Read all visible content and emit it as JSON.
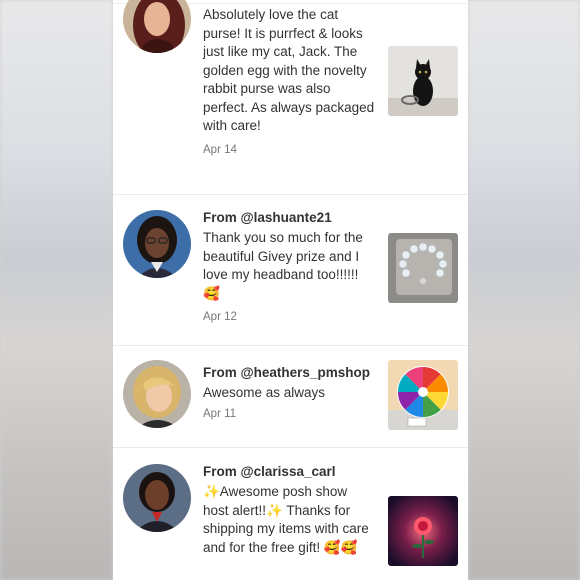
{
  "reviews": [
    {
      "from": "",
      "text": "Absolutely love the cat purse! It is purrfect & looks just like my cat, Jack. The golden egg with the novelty rabbit purse was also perfect. As always packaged with care!",
      "date": "Apr 14",
      "avatar_icon": "woman-with-red-hair-avatar",
      "thumb_icon": "black-cat-purse-photo"
    },
    {
      "from": "From @lashuante21",
      "text": "Thank you so much for the beautiful Givey prize and I love my headband too!!!!!!🥰",
      "date": "Apr 12",
      "avatar_icon": "woman-with-glasses-avatar",
      "thumb_icon": "bead-bracelet-photo"
    },
    {
      "from": "From @heathers_pmshop",
      "text": "Awesome as always",
      "date": "Apr 11",
      "avatar_icon": "blonde-woman-avatar",
      "thumb_icon": "prize-wheel-photo"
    },
    {
      "from": "From @clarissa_carl",
      "text": "✨Awesome posh show host alert!!✨ Thanks for shipping my items with care and for the free gift! 🥰🥰",
      "date": "",
      "avatar_icon": "smiling-woman-avatar",
      "thumb_icon": "rose-art-photo"
    }
  ],
  "colors": {
    "text": "#333333",
    "date": "#777777",
    "divider": "#ebebeb",
    "panel": "#ffffff"
  }
}
